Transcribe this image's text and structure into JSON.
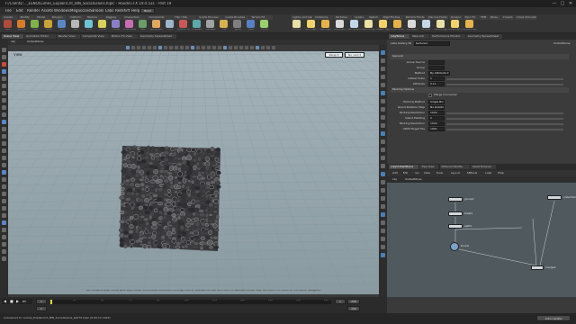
{
  "window": {
    "title": "F:/Clients/..._ESNO/Lumes_ExplainCrit_BIN_SocialGrains.hiplc - Houdini FX 19.0.531 - Part 19",
    "minimize": "—",
    "maximize": "□",
    "close": "✕"
  },
  "menu": [
    "File",
    "Edit",
    "Render",
    "Assets",
    "Windows",
    "Megascans",
    "SBTools",
    "Labs",
    "Redshift",
    "Help"
  ],
  "desktop_selector": "Build",
  "shelf": {
    "tabs": [
      "Create",
      "Modify",
      "Model",
      "Polygon",
      "Deform",
      "Texture",
      "Rigging",
      "Characters",
      "Constraints",
      "Hair Utils",
      "Guide Process",
      "Guide Brushes",
      "Terrain FX"
    ],
    "right_tabs": [
      "Lights and Cameras",
      "Collisions",
      "Particles",
      "Grains",
      "Vellum",
      "Rigid Bodies",
      "Particle Fluids",
      "Viscous Fluids",
      "Oceans",
      "Pyro FX",
      "FEM",
      "Wires",
      "Crowds",
      "Drive Simulation"
    ],
    "tools": [
      "Box",
      "Sphere",
      "Tube",
      "Torus",
      "Grid",
      "Null",
      "Line",
      "Circle",
      "Curve",
      "Draw Curve",
      "Path",
      "Spray Paint",
      "Font",
      "Platonic Solids",
      "L-System",
      "Metaball",
      "File",
      "Spiral",
      "Helix",
      "Coord"
    ],
    "right_tools": [
      "Camera",
      "Point Light",
      "Spot Light",
      "Area Light",
      "Geometry Light",
      "Volume Light",
      "Distant Light",
      "Environment Light",
      "Sky Light",
      "GI Light",
      "Caustic Light",
      "Portal Light",
      "Ambient Light"
    ]
  },
  "left_tabs": [
    "Scene View",
    "Animation Editor",
    "Render View",
    "Composite View",
    "Motion FX View",
    "Geometry Spreadsheet"
  ],
  "left_path": "obj",
  "left_path_node": "UnitedStone",
  "viewport": {
    "label": "View",
    "camera_menu": "Persp ▾",
    "cam_menu": "No cam ▾",
    "status_text": "Left mouse tumbles. Middle pans. Right dollies. Ctrl+Alt+Left box-zooms. Ctrl+Right zooms. Spacebar-Ctrl-Left tilts. Hold L for alternate tumble, dolly, and zoom. M or Alt+M for First Person Navigation."
  },
  "timeline": {
    "frame": "1",
    "start": "1",
    "end": "240",
    "ticks": [
      "24",
      "48",
      "72",
      "96",
      "120",
      "144",
      "168",
      "192",
      "216",
      "240"
    ],
    "range_start": "1",
    "range_end": "240"
  },
  "statusbar": {
    "text": "Autosaved to: Lumes_ExplainCrit_BIN_SocialGrains_bak79.hiplc (0:00:12 2023)",
    "auto_update": "Auto Update"
  },
  "param": {
    "tabs": [
      "/obj/Stone",
      "Take List",
      "Performance Monitor",
      "Geometry Spreadsheet"
    ],
    "node_type": "Labs Gallery Pa",
    "node_name": "textured",
    "path_label": "UnitedStone",
    "section_main": "General",
    "fields": [
      {
        "label": "Group Source",
        "value": ""
      },
      {
        "label": "Group",
        "value": ""
      },
      {
        "label": "Method",
        "value": "By Attribute ▾"
      },
      {
        "label": "Global Scale",
        "value": "1"
      },
      {
        "label": "Attribute",
        "value": "0.11"
      },
      {
        "label": "Merge Threshold",
        "value": "0.5"
      }
    ],
    "section_packing": "Packing Options",
    "checkbox_label": "Merge Connected",
    "fields2": [
      {
        "label": "Packing Method",
        "value": "Single Brush Tiles"
      },
      {
        "label": "Island Rotation Step",
        "value": "No Rotation"
      },
      {
        "label": "Packing Resolution",
        "value": "1024"
      },
      {
        "label": "Island Padding",
        "value": "2"
      },
      {
        "label": "Packing Resolution",
        "value": "1024"
      },
      {
        "label": "UDIM Target Tile",
        "value": "1001"
      }
    ]
  },
  "network": {
    "tabs": [
      "/obj/UnitedStone",
      "Tree View",
      "Material Palette",
      "Asset Browser"
    ],
    "menu": [
      "Add",
      "Edit",
      "Go",
      "View",
      "Tools",
      "Layout",
      "SBTools",
      "Labs",
      "Help"
    ],
    "path": "obj",
    "path_node": "UnitedStone",
    "nodes": [
      {
        "name": "group1"
      },
      {
        "name": "blast1"
      },
      {
        "name": "split1"
      },
      {
        "name": "bound"
      },
      {
        "name": "merge1"
      },
      {
        "name": "collection"
      }
    ]
  },
  "colors": {
    "viewport_top": "#a4b3ba",
    "viewport_bottom": "#8a9aa1",
    "grid": "#7f9096",
    "stone_fill": "#3b3b3e",
    "stone_highlight": "#a9a9ad",
    "node_blue": "#7da0c9",
    "selection": "#f5d34a"
  }
}
